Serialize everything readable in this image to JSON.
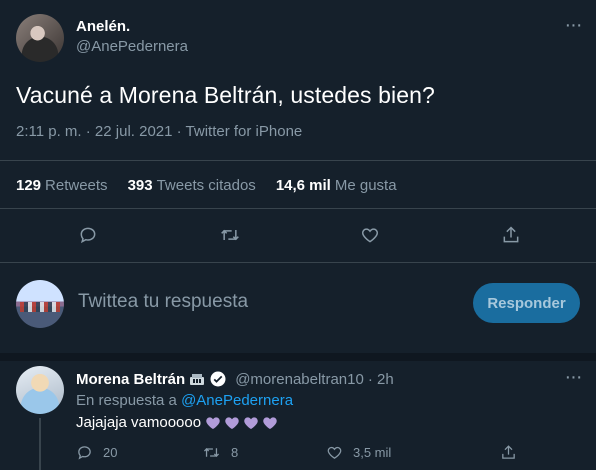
{
  "tweet": {
    "author_name": "Anelén.",
    "author_handle": "@AnePedernera",
    "text": "Vacuné a Morena Beltrán, ustedes bien?",
    "meta": "2:11 p. m. · 22 jul. 2021 · Twitter for iPhone",
    "stats": {
      "retweets_count": "129",
      "retweets_label": "Retweets",
      "quotes_count": "393",
      "quotes_label": "Tweets citados",
      "likes_count": "14,6 mil",
      "likes_label": "Me gusta"
    },
    "actions": [
      "reply-icon",
      "retweet-icon",
      "like-icon",
      "share-icon"
    ]
  },
  "compose": {
    "placeholder": "Twittea tu respuesta",
    "button_label": "Responder"
  },
  "reply": {
    "author_name": "Morena Beltrán",
    "author_handle": "@morenabeltran10",
    "time": "· 2h",
    "in_reply_prefix": "En respuesta a",
    "in_reply_handle": "@AnePedernera",
    "text": "Jajajaja vamooooo",
    "hearts": 4,
    "heart_color": "#b19cd9",
    "reply_count": "20",
    "retweet_count": "8",
    "like_count": "3,5 mil"
  },
  "colors": {
    "background": "#15202b",
    "accent": "#1da1f2",
    "muted": "#8899a6",
    "divider": "#38444d"
  }
}
